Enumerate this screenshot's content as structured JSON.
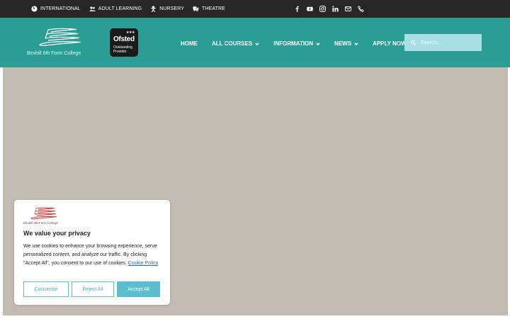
{
  "topbar": {
    "links": [
      {
        "label": "INTERNATIONAL",
        "icon": "globe-icon"
      },
      {
        "label": "ADULT LEARNING",
        "icon": "users-icon"
      },
      {
        "label": "NURSERY",
        "icon": "baby-icon"
      },
      {
        "label": "THEATRE",
        "icon": "theatre-masks-icon"
      }
    ],
    "socials": [
      "facebook-icon",
      "youtube-icon",
      "instagram-icon",
      "linkedin-icon",
      "email-icon",
      "phone-icon"
    ]
  },
  "header": {
    "logo_text": "Bexhill 6th Form College",
    "ofsted": {
      "title": "Ofsted",
      "line1": "Outstanding",
      "line2": "Provider",
      "stars": "★★★"
    },
    "nav": [
      {
        "label": "HOME",
        "dropdown": false
      },
      {
        "label": "ALL COURSES",
        "dropdown": true
      },
      {
        "label": "INFORMATION",
        "dropdown": true
      },
      {
        "label": "NEWS",
        "dropdown": true
      },
      {
        "label": "APPLY NOW",
        "dropdown": false
      }
    ],
    "search_placeholder": "Search..."
  },
  "cookie": {
    "logo_text": "Bexhill 6th Form College",
    "title": "We value your privacy",
    "body": "We use cookies to enhance your browsing experience, serve personalized content, and analyze our traffic. By clicking \"Accept All\", you consent to our use of cookies.",
    "policy_link": "Cookie Policy",
    "buttons": {
      "customize": "Customize",
      "reject": "Reject All",
      "accept": "Accept All"
    }
  },
  "colors": {
    "topbar": "#262626",
    "header": "#2a9d95",
    "hero": "#c2bbb2",
    "accent": "#59c0cf",
    "search": "#a8dee5"
  }
}
